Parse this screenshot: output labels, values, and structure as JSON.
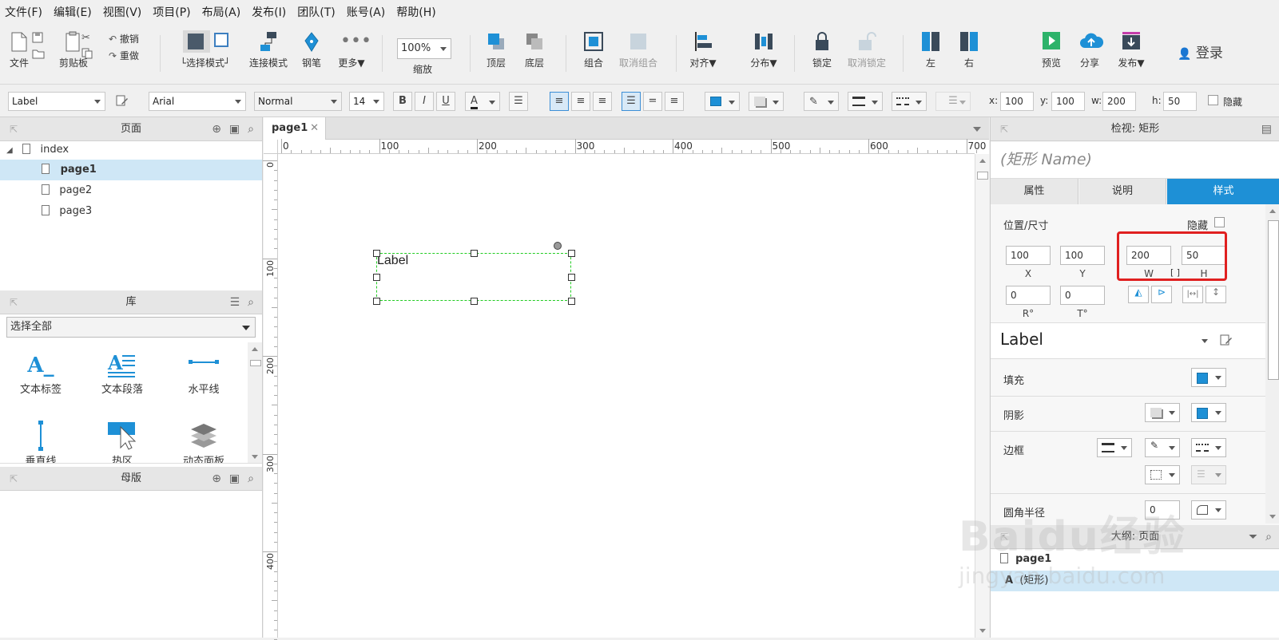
{
  "menu": [
    "文件(F)",
    "编辑(E)",
    "视图(V)",
    "项目(P)",
    "布局(A)",
    "发布(I)",
    "团队(T)",
    "账号(A)",
    "帮助(H)"
  ],
  "toolbar": {
    "file": "文件",
    "clipboard": "剪贴板",
    "undo": "撤销",
    "redo": "重做",
    "select_mode": "└选择模式┘",
    "connect_mode": "连接模式",
    "pen": "钢笔",
    "more": "更多▼",
    "zoom_value": "100%",
    "zoom": "缩放",
    "top_layer": "顶层",
    "bottom_layer": "底层",
    "group": "组合",
    "ungroup": "取消组合",
    "align": "对齐▼",
    "distribute": "分布▼",
    "lock": "锁定",
    "unlock": "取消锁定",
    "left": "左",
    "right": "右",
    "preview": "预览",
    "share": "分享",
    "publish": "发布▼",
    "login": "登录"
  },
  "format": {
    "style": "Label",
    "font": "Arial",
    "weight": "Normal",
    "size": "14",
    "bold": "B",
    "italic": "I",
    "underline": "U",
    "x_label": "x:",
    "x": "100",
    "y_label": "y:",
    "y": "100",
    "w_label": "w:",
    "w": "200",
    "h_label": "h:",
    "h": "50",
    "hidden": "隐藏"
  },
  "pages_panel": {
    "title": "页面",
    "items": [
      {
        "label": "index"
      },
      {
        "label": "page1"
      },
      {
        "label": "page2"
      },
      {
        "label": "page3"
      }
    ]
  },
  "library": {
    "title": "库",
    "filter": "选择全部",
    "items": [
      "文本标签",
      "文本段落",
      "水平线",
      "垂直线",
      "热区",
      "动态面板"
    ]
  },
  "masters": {
    "title": "母版"
  },
  "canvas": {
    "tab": "page1",
    "ruler_h": [
      "0",
      "100",
      "200",
      "300",
      "400",
      "500",
      "600",
      "700"
    ],
    "ruler_v": [
      "0",
      "100",
      "200",
      "300",
      "400"
    ],
    "widget_text": "Label"
  },
  "inspector": {
    "title": "检视: 矩形",
    "name_placeholder": "(矩形 Name)",
    "tabs": [
      "属性",
      "说明",
      "样式"
    ],
    "active_tab": "样式",
    "pos_size": "位置/尺寸",
    "hidden": "隐藏",
    "x": "100",
    "y": "100",
    "w": "200",
    "h": "50",
    "x_lab": "X",
    "y_lab": "Y",
    "w_lab": "W",
    "h_lab": "H",
    "r": "0",
    "t": "0",
    "r_lab": "R°",
    "t_lab": "T°",
    "style_name": "Label",
    "fill": "填充",
    "shadow": "阴影",
    "border": "边框",
    "radius": "圆角半径",
    "radius_value": "0"
  },
  "outline": {
    "title": "大纲: 页面",
    "page": "page1",
    "item": "(矩形)"
  },
  "watermark": {
    "line1": "Baidu经验",
    "line2": "jingyan.baidu.com"
  },
  "colors": {
    "accent": "#1e90d6",
    "highlight": "#e02020",
    "selection": "#22cc22"
  }
}
